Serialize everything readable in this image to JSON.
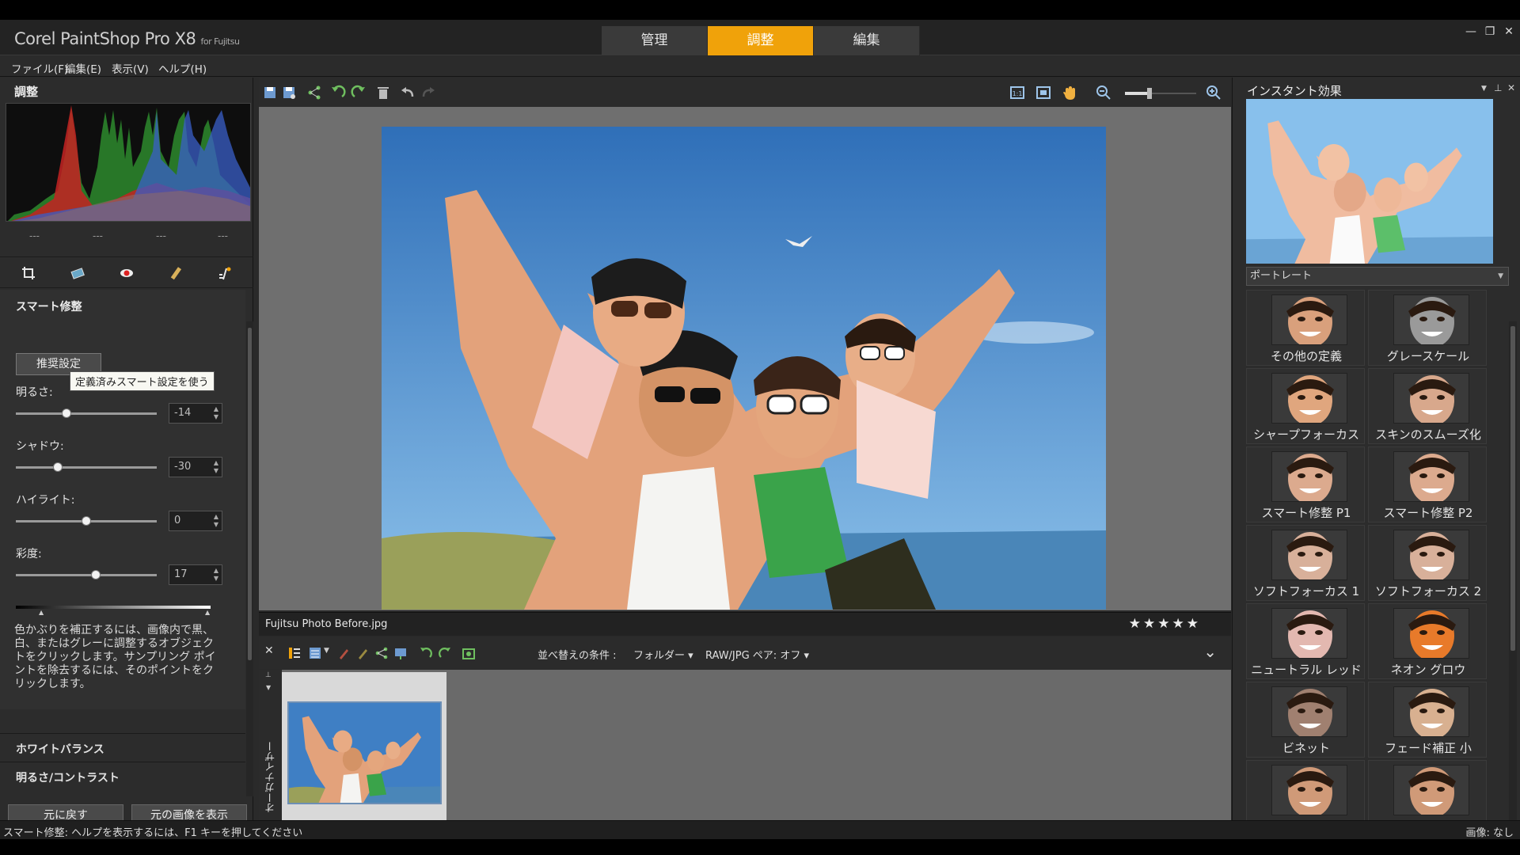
{
  "window": {
    "app_name": "Corel PaintShop Pro X8",
    "app_suffix": "for Fujitsu",
    "controls": {
      "minimize": "—",
      "restore": "❐",
      "close": "✕"
    }
  },
  "mode_tabs": [
    {
      "label": "管理",
      "active": false
    },
    {
      "label": "調整",
      "active": true
    },
    {
      "label": "編集",
      "active": false
    }
  ],
  "menu": [
    "ファイル(F)",
    "編集(E)",
    "表示(V)",
    "ヘルプ(H)"
  ],
  "left_panel": {
    "title": "調整",
    "histogram_values": [
      "---",
      "---",
      "---",
      "---"
    ],
    "tools": [
      "crop-icon",
      "straighten-icon",
      "red-eye-icon",
      "retouch-brush-icon",
      "depth-of-field-icon"
    ],
    "smart_fix": {
      "title": "スマート修整",
      "recommended_button": "推奨設定",
      "tooltip": "定義済みスマート設定を使う",
      "sliders": [
        {
          "label": "明るさ:",
          "value": "-14",
          "level": 0.36
        },
        {
          "label": "シャドウ:",
          "value": "-30",
          "level": 0.3
        },
        {
          "label": "ハイライト:",
          "value": "0",
          "level": 0.5
        },
        {
          "label": "彩度:",
          "value": "17",
          "level": 0.57
        }
      ],
      "description": "色かぶりを補正するには、画像内で黒、白、またはグレーに調整するオブジェクトをクリックします。サンプリング ポイントを除去するには、そのポイントをクリックします。"
    },
    "sections": [
      "ホワイトバランス",
      "明るさ/コントラスト"
    ],
    "buttons": {
      "reset": "元に戻す",
      "show_original": "元の画像を表示"
    }
  },
  "photo": {
    "file_name": "Fujitsu Photo Before.jpg",
    "rating": "★★★★★"
  },
  "organizer": {
    "sort_label": "並べ替えの条件 :",
    "sort_value": "フォルダー ▾",
    "raw_pair": "RAW/JPG ペア: オフ ▾",
    "vertical_label": "オーガナイザー",
    "collapse": "⌄"
  },
  "right_panel": {
    "title": "インスタント効果",
    "category": "ポートレート",
    "effects": [
      "その他の定義",
      "グレースケール",
      "シャープフォーカス",
      "スキンのスムーズ化",
      "スマート修整 P1",
      "スマート修整 P2",
      "ソフトフォーカス 1",
      "ソフトフォーカス 2",
      "ニュートラル レッド",
      "ネオン グロウ",
      "ビネット",
      "フェード補正 小",
      "",
      ""
    ]
  },
  "status": {
    "left": "スマート修整: ヘルプを表示するには、F1 キーを押してください",
    "right": "画像: なし"
  },
  "colors": {
    "accent": "#f0a20a",
    "panel": "#2c2c2c",
    "canvas": "#6f6f6f"
  }
}
